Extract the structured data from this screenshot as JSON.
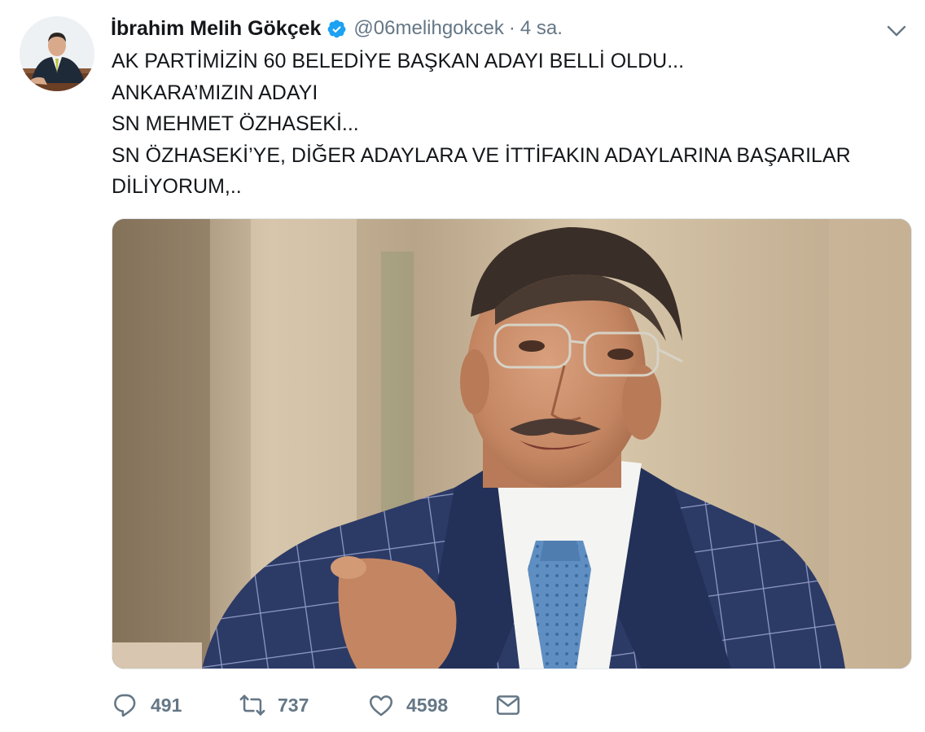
{
  "tweet": {
    "author": {
      "display_name": "İbrahim Melih Gökçek",
      "verified_icon": "verified-badge-icon",
      "handle": "@06melihgokcek"
    },
    "separator": "·",
    "time": "4 sa.",
    "text_lines": [
      "AK PARTİMİZİN 60 BELEDİYE BAŞKAN ADAYI BELLİ OLDU...",
      "ANKARA’MIZIN ADAYI",
      "SN MEHMET ÖZHASEKİ...",
      "SN ÖZHASEKİ’YE, DİĞER ADAYLARA VE İTTİFAKIN ADAYLARINA BAŞARILAR",
      "DİLİYORUM,.."
    ],
    "media": {
      "type": "photo",
      "description_icon": "photo-man-in-checked-suit"
    },
    "actions": {
      "reply": {
        "icon": "reply-icon",
        "count": "491"
      },
      "retweet": {
        "icon": "retweet-icon",
        "count": "737"
      },
      "like": {
        "icon": "heart-icon",
        "count": "4598"
      },
      "dm": {
        "icon": "envelope-icon"
      }
    },
    "colors": {
      "text": "#14171a",
      "secondary": "#657786",
      "verified": "#1da1f2"
    }
  }
}
